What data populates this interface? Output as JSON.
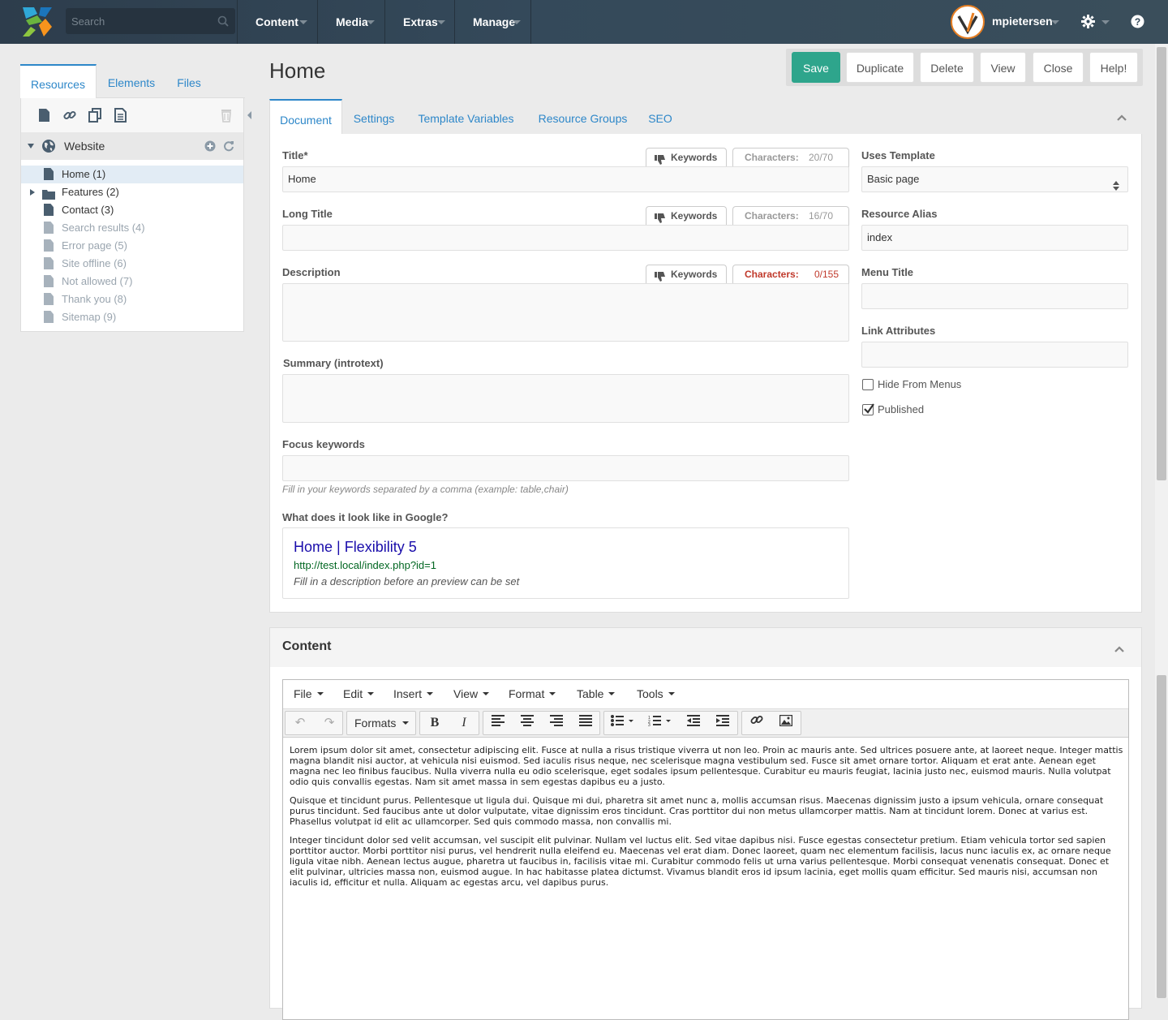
{
  "topbar": {
    "search_placeholder": "Search",
    "nav": [
      "Content",
      "Media",
      "Extras",
      "Manage"
    ],
    "username": "mpietersen"
  },
  "left_panel": {
    "tabs": [
      "Resources",
      "Elements",
      "Files"
    ],
    "root": "Website",
    "tree": [
      {
        "label": "Home (1)",
        "active": true,
        "faded": false
      },
      {
        "label": "Features (2)",
        "folder": true,
        "faded": false
      },
      {
        "label": "Contact (3)",
        "faded": false
      },
      {
        "label": "Search results (4)",
        "faded": true
      },
      {
        "label": "Error page (5)",
        "faded": true
      },
      {
        "label": "Site offline (6)",
        "faded": true
      },
      {
        "label": "Not allowed (7)",
        "faded": true
      },
      {
        "label": "Thank you (8)",
        "faded": true
      },
      {
        "label": "Sitemap (9)",
        "faded": true
      }
    ]
  },
  "page": {
    "title": "Home",
    "actions": [
      "Save",
      "Duplicate",
      "Delete",
      "View",
      "Close",
      "Help!"
    ]
  },
  "doc_tabs": [
    "Document",
    "Settings",
    "Template Variables",
    "Resource Groups",
    "SEO"
  ],
  "form": {
    "title_label": "Title*",
    "title_value": "Home",
    "title_chars": "20/70",
    "longtitle_label": "Long Title",
    "longtitle_chars": "16/70",
    "description_label": "Description",
    "description_chars": "0/155",
    "keywords_chip": "Keywords",
    "characters_chip": "Characters:",
    "summary_label": "Summary (introtext)",
    "focus_label": "Focus keywords",
    "focus_help": "Fill in your keywords separated by a comma (example: table,chair)",
    "google_label": "What does it look like in Google?",
    "google_title": "Home | Flexibility 5",
    "google_url": "http://test.local/index.php?id=1",
    "google_desc": "Fill in a description before an preview can be set",
    "template_label": "Uses Template",
    "template_value": "Basic page",
    "alias_label": "Resource Alias",
    "alias_value": "index",
    "menutitle_label": "Menu Title",
    "linkattr_label": "Link Attributes",
    "hide_menus_label": "Hide From Menus",
    "published_label": "Published"
  },
  "content": {
    "title": "Content",
    "menu": [
      "File",
      "Edit",
      "Insert",
      "View",
      "Format",
      "Table",
      "Tools"
    ],
    "formats_label": "Formats",
    "paragraphs": [
      "Lorem ipsum dolor sit amet, consectetur adipiscing elit. Fusce at nulla a risus tristique viverra ut non leo. Proin ac mauris ante. Sed ultrices posuere ante, at laoreet neque. Integer mattis magna blandit nisi auctor, at vehicula nisi euismod. Sed iaculis risus neque, nec scelerisque magna vestibulum sed. Fusce sit amet ornare tortor. Aliquam et erat ante. Aenean eget magna nec leo finibus faucibus. Nulla viverra nulla eu odio scelerisque, eget sodales ipsum pellentesque. Curabitur eu mauris feugiat, lacinia justo nec, euismod mauris. Nulla volutpat odio quis convallis egestas. Nam sit amet massa in sem egestas dapibus eu a justo.",
      "Quisque et tincidunt purus. Pellentesque ut ligula dui. Quisque mi dui, pharetra sit amet nunc a, mollis accumsan risus. Maecenas dignissim justo a ipsum vehicula, ornare consequat purus tincidunt. Sed faucibus ante ut dolor vulputate, vitae dignissim eros tincidunt. Cras porttitor dui non metus ullamcorper mattis. Nam at tincidunt lorem. Donec at varius est. Phasellus volutpat id elit ac ullamcorper. Sed quis commodo massa, non convallis mi.",
      "Integer tincidunt dolor sed velit accumsan, vel suscipit elit pulvinar. Nullam vel luctus elit. Sed vitae dapibus nisi. Fusce egestas consectetur pretium. Etiam vehicula tortor sed sapien porttitor auctor. Morbi porttitor nisi purus, vel hendrerit nulla eleifend eu. Maecenas vel erat diam. Donec laoreet, quam nec elementum facilisis, lacus nunc iaculis ex, ac ornare neque ligula vitae nibh. Aenean lectus augue, pharetra ut faucibus in, facilisis vitae mi. Curabitur commodo felis ut urna varius pellentesque. Morbi consequat venenatis consequat. Donec et elit pulvinar, ultricies massa non, euismod augue. In hac habitasse platea dictumst. Vivamus blandit eros id ipsum lacinia, eget mollis quam efficitur. Sed mauris nisi, accumsan non iaculis id, efficitur et nulla. Aliquam ac egestas arcu, vel dapibus purus."
    ]
  },
  "colors": {
    "accent": "#2d87c9",
    "save": "#2ea58c",
    "topbar": "#34495a",
    "warning": "#c0392b"
  }
}
